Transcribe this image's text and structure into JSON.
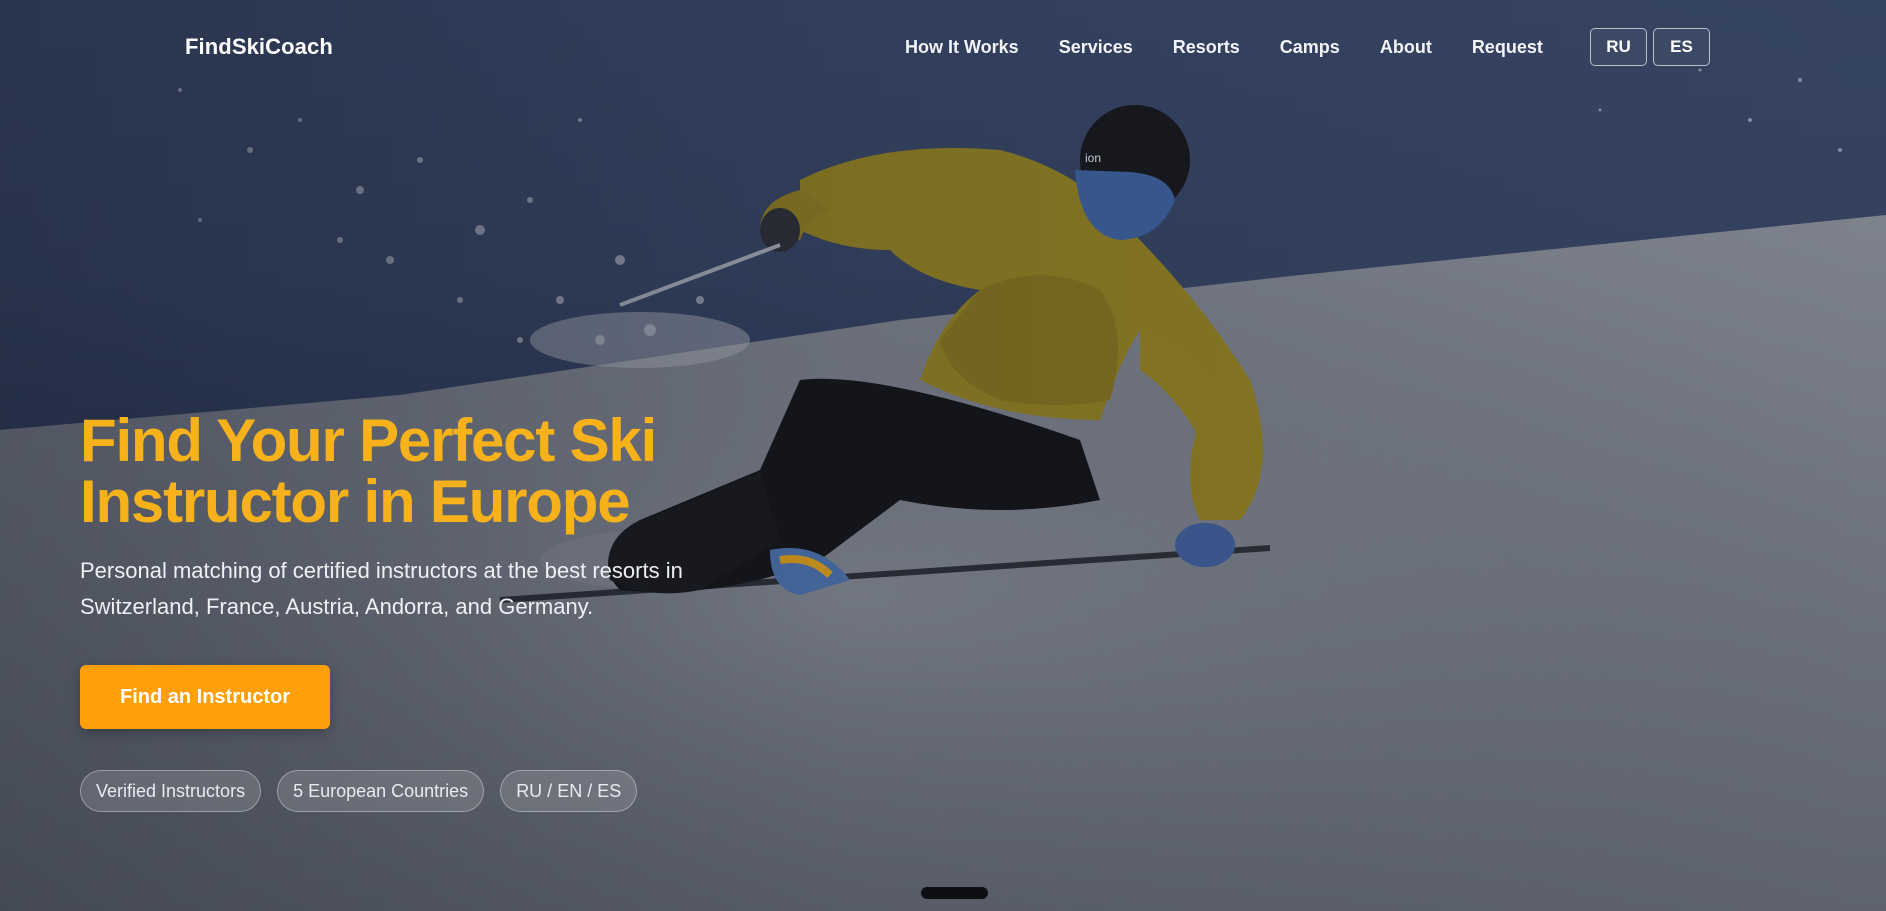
{
  "brand": "FindSkiCoach",
  "nav": {
    "links": [
      "How It Works",
      "Services",
      "Resorts",
      "Camps",
      "About",
      "Request"
    ],
    "languages": [
      "RU",
      "ES"
    ]
  },
  "hero": {
    "headline_line1": "Find Your Perfect Ski",
    "headline_line2": "Instructor in Europe",
    "subtitle_line1": "Personal matching of certified instructors at the best resorts in",
    "subtitle_line2": "Switzerland, France, Austria, Andorra, and Germany.",
    "cta_label": "Find an Instructor",
    "badges": [
      "Verified Instructors",
      "5 European Countries",
      "RU / EN / ES"
    ]
  },
  "colors": {
    "accent": "#f7b21b",
    "cta": "#ff9f0a",
    "sky": "#2e3b59"
  },
  "icons": {
    "scroll": "scroll-indicator"
  }
}
